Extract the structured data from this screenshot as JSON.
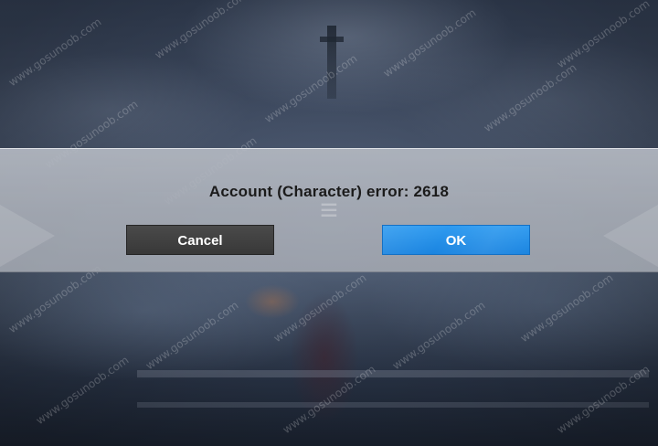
{
  "dialog": {
    "message": "Account (Character) error: 2618",
    "cancel_label": "Cancel",
    "ok_label": "OK"
  },
  "watermark": {
    "text": "www.gosunoob.com"
  },
  "colors": {
    "ok_button": "#1a84e0",
    "cancel_button": "#383838",
    "dialog_band": "#b4b9c2",
    "message_text": "#1b1b1b"
  },
  "icons": {
    "band_emblem": "game-logo-emblem"
  }
}
